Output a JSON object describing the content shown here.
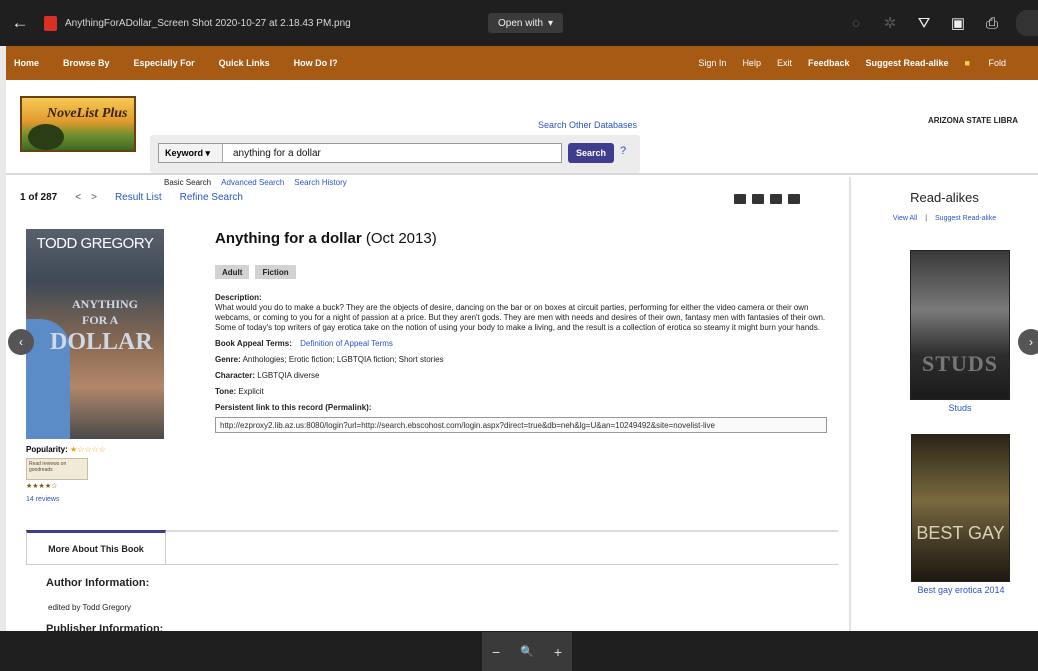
{
  "viewer": {
    "filename": "AnythingForADollar_Screen Shot 2020-10-27 at 2.18.43 PM.png",
    "open_with": "Open with",
    "zoom_out": "−",
    "zoom_icon": "🔍",
    "zoom_in": "+"
  },
  "nav": {
    "left": [
      "Home",
      "Browse By",
      "Especially For",
      "Quick Links",
      "How Do I?"
    ],
    "right": [
      "Sign In",
      "Help",
      "Exit",
      "Feedback",
      "Suggest Read-alike",
      "Fold"
    ]
  },
  "header": {
    "logo_text": "NoveList Plus",
    "search_other": "Search Other Databases",
    "library": "ARIZONA STATE LIBRA",
    "keyword_select": "Keyword ▾",
    "search_value": "anything for a dollar",
    "search_button": "Search",
    "help": "?",
    "basic_search": "Basic Search",
    "advanced_search": "Advanced Search",
    "search_history": "Search History"
  },
  "results": {
    "count": "1 of 287",
    "prev": "<",
    "next": ">",
    "result_list": "Result List",
    "refine_search": "Refine Search"
  },
  "book": {
    "cover_author": "TODD GREGORY",
    "cover_title_1": "ANYTHING",
    "cover_title_2": "FOR A",
    "cover_title_3": "DOLLAR",
    "title": "Anything for a dollar",
    "date": "(Oct 2013)",
    "tags": [
      "Adult",
      "Fiction"
    ],
    "description_label": "Description:",
    "description": "What would you do to make a buck? They are the objects of desire, dancing on the bar or on boxes at circuit parties, performing for either the video camera or their own webcams, or coming to you for a night of passion at a price. But they aren't gods. They are men with needs and desires of their own, fantasy men with fantasies of their own. Some of today's top writers of gay erotica take on the notion of using your body to make a living, and the result is a collection of erotica so steamy it might burn your hands.",
    "appeal_label": "Book Appeal Terms:",
    "appeal_link": "Definition of Appeal Terms",
    "genre_label": "Genre:",
    "genre": "Anthologies; Erotic fiction; LGBTQIA fiction; Short stories",
    "character_label": "Character:",
    "character": "LGBTQIA diverse",
    "tone_label": "Tone:",
    "tone": "Explicit",
    "permalink_label": "Persistent link to this record (Permalink):",
    "permalink": "http://ezproxy2.lib.az.us:8080/login?url=http://search.ebscohost.com/login.aspx?direct=true&db=neh&lg=U&an=10249492&site=novelist-live",
    "popularity_label": "Popularity:",
    "popularity_stars": "★☆☆☆☆",
    "goodreads_badge": "Read reviews on goodreads",
    "goodreads_rating": "★★★★☆",
    "reviews": "14 reviews",
    "tab_label": "More About This Book",
    "author_info_label": "Author Information:",
    "author_info": "edited by Todd Gregory",
    "publisher_info_label": "Publisher Information:"
  },
  "sidebar": {
    "title": "Read-alikes",
    "view_all": "View All",
    "separator": "|",
    "suggest": "Suggest Read-alike",
    "book1_cover_text": "STUDS",
    "book1_caption": "Studs",
    "book2_cover_text": "BEST GAY",
    "book2_caption": "Best gay erotica 2014"
  }
}
